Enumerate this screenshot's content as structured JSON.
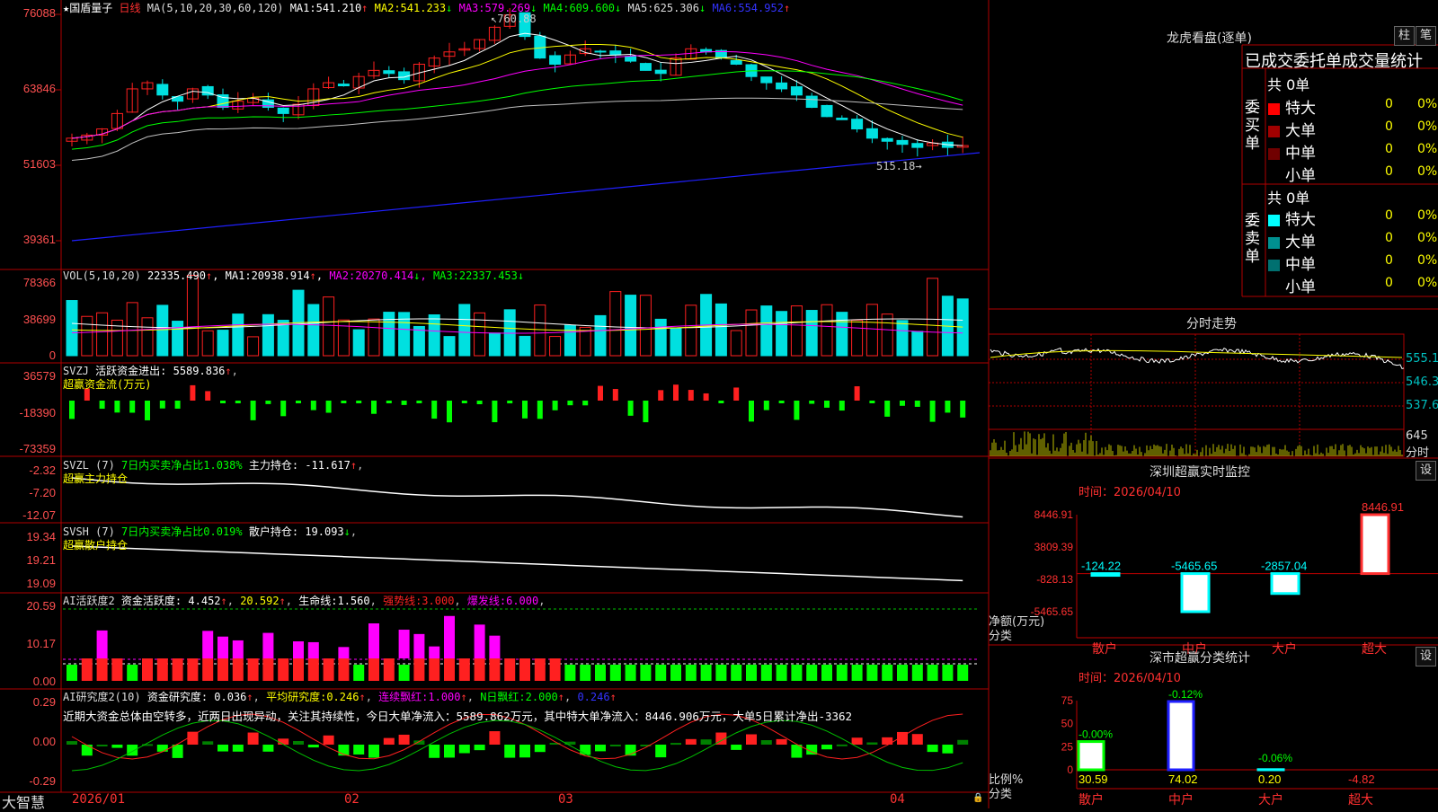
{
  "colors": {
    "up": "#ff2020",
    "down": "#00e0e0",
    "grid": "#b00000",
    "ma1": "#ffffff",
    "ma2": "#ffff00",
    "ma3": "#ff00ff",
    "ma4": "#00ff00",
    "ma5": "#c0c0c0",
    "ma6": "#2020ff",
    "green": "#00ff00"
  },
  "stock": {
    "name": "国盾量子",
    "period": "日线",
    "star": "★"
  },
  "main_panel": {
    "ma_title": "MA(5,10,20,30,60,120)",
    "ma": [
      {
        "label": "MA1:",
        "value": "541.210",
        "arrow": "↑"
      },
      {
        "label": "MA2:",
        "value": "541.233",
        "arrow": "↓"
      },
      {
        "label": "MA3:",
        "value": "579.269",
        "arrow": "↓"
      },
      {
        "label": "MA4:",
        "value": "609.600",
        "arrow": "↓"
      },
      {
        "label": "MA5:",
        "value": "625.306",
        "arrow": "↓"
      },
      {
        "label": "MA6:",
        "value": "554.952",
        "arrow": "↑"
      }
    ],
    "axis": [
      "76088",
      "63846",
      "51603",
      "39361"
    ],
    "high_label": "760.88",
    "low_label": "515.18"
  },
  "vol_panel": {
    "title": "VOL(5,10,20)",
    "value": "22335.490",
    "arrow": "↑",
    "ma": [
      {
        "label": "MA1:",
        "value": "20938.914",
        "arrow": "↑"
      },
      {
        "label": "MA2:",
        "value": "20270.414",
        "arrow": "↓"
      },
      {
        "label": "MA3:",
        "value": "22337.453",
        "arrow": "↓"
      }
    ],
    "axis": [
      "78366",
      "38699",
      "0"
    ]
  },
  "svzj_panel": {
    "title": "SVZJ",
    "label": "活跃资金进出:",
    "value": "5589.836",
    "arrow": "↑",
    "sub": "超赢资金流(万元)",
    "axis": [
      "36579",
      "-18390",
      "-73359"
    ]
  },
  "svzl_panel": {
    "title": "SVZL (7)",
    "green_text": "7日内买卖净占比1.038%",
    "label": "主力持仓:",
    "value": "-11.617",
    "arrow": "↑",
    "sub": "超赢主力持仓",
    "axis": [
      "-2.32",
      "-7.20",
      "-12.07"
    ]
  },
  "svsh_panel": {
    "title": "SVSH (7)",
    "green_text": "7日内买卖净占比0.019%",
    "label": "散户持仓:",
    "value": "19.093",
    "arrow": "↓",
    "sub": "超赢散户持仓",
    "axis": [
      "19.34",
      "19.21",
      "19.09"
    ]
  },
  "ai_panel": {
    "title": "AI活跃度2",
    "label": "资金活跃度:",
    "value": "4.452",
    "arrow": "↑",
    "v2": "20.592",
    "life": "生命线:",
    "life_v": "1.560",
    "strong": "强势线:",
    "strong_v": "3.000",
    "burst": "爆发线:",
    "burst_v": "6.000",
    "axis": [
      "20.59",
      "10.17",
      "0.00"
    ]
  },
  "research_panel": {
    "title": "AI研究度2(10)",
    "label": "资金研究度:",
    "value": "0.036",
    "avg": "平均研究度:",
    "avg_v": "0.246",
    "red": "连续飘红:",
    "red_v": "1.000",
    "nred": "N日飘红:",
    "nred_v": "2.000",
    "last": "0.246",
    "text": "近期大资金总体由空转多，近两日出现异动，关注其持续性，今日大单净流入：5589.862万元，其中特大单净流入：8446.906万元，大单5日累计净出-3362",
    "axis": [
      "0.29",
      "0.00",
      "-0.29"
    ]
  },
  "date_axis": [
    "2026/01",
    "02",
    "03",
    "04"
  ],
  "brand": "大智慧",
  "right": {
    "lhb_title": "龙虎看盘(逐单)",
    "btn_zhu": "柱",
    "btn_bi": "笔",
    "order_title": "已成交委托单成交量统计",
    "buy": {
      "side": "委买单",
      "total": "共 0单",
      "rows": [
        {
          "name": "特大",
          "v": "0",
          "p": "0%",
          "c": "#ff0000"
        },
        {
          "name": "大单",
          "v": "0",
          "p": "0%",
          "c": "#a00000"
        },
        {
          "name": "中单",
          "v": "0",
          "p": "0%",
          "c": "#700000"
        },
        {
          "name": "小单",
          "v": "0",
          "p": "0%",
          "c": "#000000"
        }
      ]
    },
    "sell": {
      "side": "委卖单",
      "total": "共 0单",
      "rows": [
        {
          "name": "特大",
          "v": "0",
          "p": "0%",
          "c": "#00ffff"
        },
        {
          "name": "大单",
          "v": "0",
          "p": "0%",
          "c": "#009090"
        },
        {
          "name": "中单",
          "v": "0",
          "p": "0%",
          "c": "#007070"
        },
        {
          "name": "小单",
          "v": "0",
          "p": "0%",
          "c": "#000000"
        }
      ]
    },
    "fenshi_title": "分时走势",
    "fenshi_axis": [
      "555.1",
      "546.3",
      "537.6",
      "645",
      "分时"
    ],
    "sz_title": "深圳超赢实时监控",
    "sz_time": "时间：2026/04/10",
    "sz_axis": [
      "8446.91",
      "3809.39",
      "-828.13",
      "-5465.65"
    ],
    "sz_ylabel": "净额(万元)",
    "sz_xlabel": "分类",
    "sz_bars": [
      {
        "cat": "散户",
        "value": -124.22,
        "label": "-124.22"
      },
      {
        "cat": "中户",
        "value": -5465.65,
        "label": "-5465.65"
      },
      {
        "cat": "大户",
        "value": -2857.04,
        "label": "-2857.04"
      },
      {
        "cat": "超大",
        "value": 8446.91,
        "label": "8446.91"
      }
    ],
    "set_label": "设",
    "cls_title": "深市超赢分类统计",
    "cls_time": "时间：2026/04/10",
    "cls_axis": [
      "75",
      "50",
      "25",
      "0"
    ],
    "cls_ylabel": "比例%",
    "cls_xlabel": "分类",
    "cls_bars": [
      {
        "cat": "散户",
        "value": 30.59,
        "label": "30.59",
        "delta": "-0.00%"
      },
      {
        "cat": "中户",
        "value": 74.02,
        "label": "74.02",
        "delta": "-0.12%"
      },
      {
        "cat": "大户",
        "value": 0.2,
        "label": "0.20",
        "delta": "-0.06%"
      },
      {
        "cat": "超大",
        "value": -4.82,
        "label": "-4.82",
        "delta": ""
      }
    ]
  }
}
